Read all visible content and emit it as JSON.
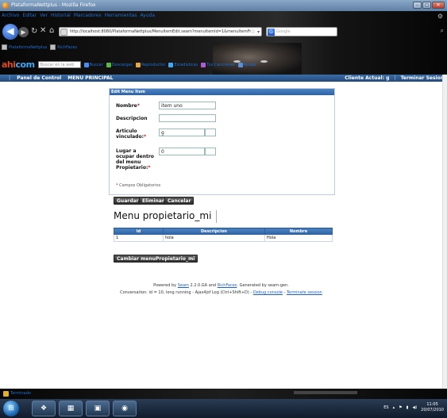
{
  "window": {
    "title": "PlataformaNettplus - Mozilla Firefox",
    "controls": [
      "–",
      "▢",
      "✕"
    ]
  },
  "browser": {
    "menu": [
      "Archivo",
      "Editar",
      "Ver",
      "Historial",
      "Marcadores",
      "Herramientas",
      "Ayuda"
    ],
    "url": "http://localhost:8080/PlataformaNettplus/MenuItemEdit.seam?menuItemId=1&menuItemFrom=MenuItem&menuItemId=1&cid=",
    "search_engine": "Google",
    "bookmarks": [
      "PlataformaNettplus",
      "RichFaces"
    ],
    "addon": {
      "logo_left": "ahi",
      "logo_right": "com",
      "search_placeholder": "Buscar en la web",
      "items": [
        "Buscar",
        "Descargas",
        "Reproductor",
        "Estadísticas",
        "Tus Canciones",
        "Ayuda"
      ]
    }
  },
  "app": {
    "nav_left": [
      "Panel de Control",
      "MENU PRINCIPAL"
    ],
    "client_label": "Cliente Actual: g",
    "logout": "Terminar Sesion"
  },
  "form": {
    "panel_title": "Edit Menu Item",
    "fields": [
      {
        "label": "Nombre",
        "required": true,
        "value": "item uno"
      },
      {
        "label": "Descripcion",
        "required": false,
        "value": ""
      },
      {
        "label": "Articulo vinculado",
        "required": true,
        "value": "g"
      },
      {
        "label": "Lugar a ocupar dentro del menu Propietario",
        "required": true,
        "value": "0"
      }
    ],
    "required_note": "Campos Obligatorios",
    "required_mark": "*"
  },
  "actions": {
    "save": "Guardar",
    "delete": "Eliminar",
    "cancel": "Cancelar"
  },
  "owner_menu": {
    "title": "Menu propietario_mi",
    "columns": [
      "Id",
      "Descripcion",
      "Nombre"
    ],
    "rows": [
      {
        "id": "1",
        "descripcion": "hola",
        "nombre": "Hola"
      }
    ],
    "change_button": "Cambiar menuPropietario_mi"
  },
  "footer": {
    "powered_prefix": "Powered by ",
    "seam_link": "Seam",
    "powered_mid": " 2.2.0.GA and ",
    "richfaces_link": "RichFaces",
    "powered_suffix": ". Generated by seam-gen.",
    "conversation_prefix": "Conversation: id = 10, long running - Ajax4jsf Log (Ctrl+Shift+D) - ",
    "debug_link": "Debug console",
    "dash": " - ",
    "terminate_link": "Terminate session"
  },
  "statusbar": {
    "label": "Terminado"
  },
  "taskbar": {
    "language": "ES",
    "time": "11:05",
    "date": "20/07/2010"
  },
  "colors": {
    "accent": "#2e62a3",
    "required": "#dd1111",
    "link": "#1e5fc4"
  }
}
